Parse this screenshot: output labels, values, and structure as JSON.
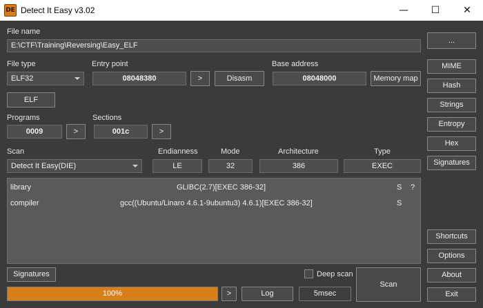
{
  "window": {
    "title": "Detect It Easy v3.02",
    "icon_text": "DE",
    "minimize_glyph": "—",
    "maximize_glyph": "☐",
    "close_glyph": "✕"
  },
  "file_name": {
    "label": "File name",
    "value": "E:\\CTF\\Training\\Reversing\\Easy_ELF"
  },
  "file_type": {
    "label": "File type",
    "value": "ELF32"
  },
  "entry_point": {
    "label": "Entry point",
    "value": "08048380",
    "go_label": ">",
    "disasm_label": "Disasm"
  },
  "base_address": {
    "label": "Base address",
    "value": "08048000",
    "memory_map_label": "Memory map"
  },
  "elf_button": "ELF",
  "programs": {
    "label": "Programs",
    "value": "0009",
    "go_label": ">"
  },
  "sections": {
    "label": "Sections",
    "value": "001c",
    "go_label": ">"
  },
  "scan": {
    "label": "Scan",
    "engine": "Detect It Easy(DIE)",
    "endianness_label": "Endianness",
    "endianness": "LE",
    "mode_label": "Mode",
    "mode": "32",
    "architecture_label": "Architecture",
    "architecture": "386",
    "type_label": "Type",
    "type": "EXEC"
  },
  "results": [
    {
      "type": "library",
      "name": "GLIBC(2.7)[EXEC 386-32]",
      "s": "S",
      "q": "?"
    },
    {
      "type": "compiler",
      "name": "gcc((Ubuntu/Linaro 4.6.1-9ubuntu3) 4.6.1)[EXEC 386-32]",
      "s": "S",
      "q": ""
    }
  ],
  "bottom": {
    "signatures_label": "Signatures",
    "deep_scan_label": "Deep scan",
    "deep_scan_checked": false,
    "progress": 1.0,
    "progress_text": "100%",
    "go_label": ">",
    "log_label": "Log",
    "time_label": "5msec",
    "scan_label": "Scan"
  },
  "sidebar": {
    "more_label": "...",
    "mime_label": "MIME",
    "hash_label": "Hash",
    "strings_label": "Strings",
    "entropy_label": "Entropy",
    "hex_label": "Hex",
    "signatures_label": "Signatures",
    "shortcuts_label": "Shortcuts",
    "options_label": "Options",
    "about_label": "About",
    "exit_label": "Exit"
  },
  "colors": {
    "background": "#3b3b3b",
    "accent": "#d97f1a",
    "field": "#4e4e4e"
  }
}
